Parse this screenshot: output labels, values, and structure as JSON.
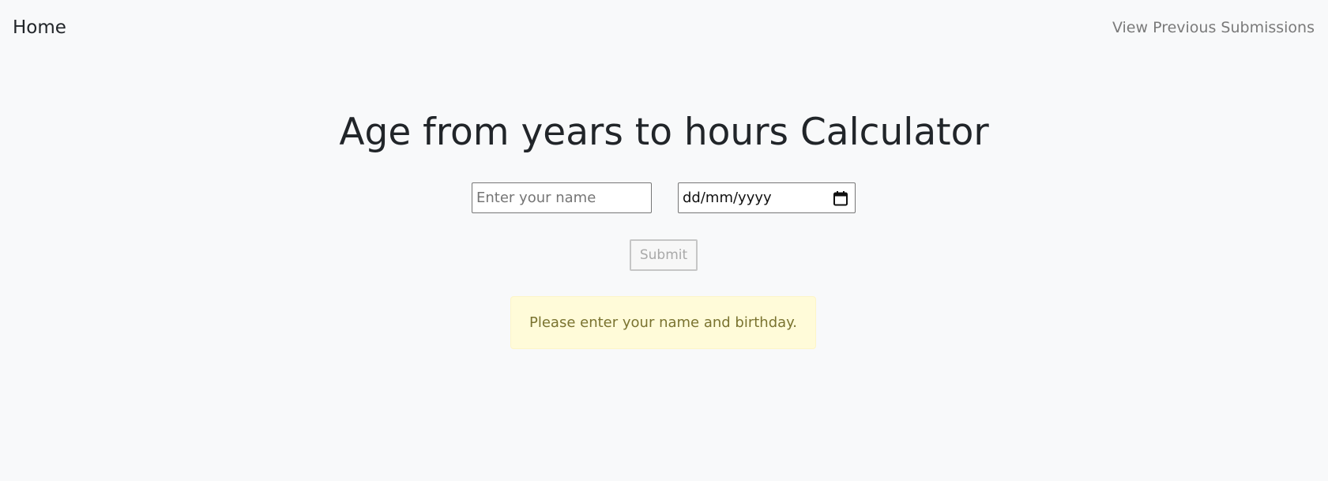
{
  "nav": {
    "home_label": "Home",
    "previous_label": "View Previous Submissions"
  },
  "page": {
    "title": "Age from years to hours Calculator"
  },
  "form": {
    "name_placeholder": "Enter your name",
    "name_value": "",
    "date_display": "dd/mm/yyyy",
    "submit_label": "Submit",
    "submit_disabled": true
  },
  "alert": {
    "message": "Please enter your name and birthday."
  },
  "colors": {
    "background": "#f8f9fa",
    "text": "#212529",
    "nav_link_muted": "#7a7a7a",
    "alert_background": "#fffbd9",
    "alert_text": "#7a7330",
    "disabled_text": "#a9a9a9"
  },
  "icons": {
    "date_picker": "calendar-icon"
  }
}
